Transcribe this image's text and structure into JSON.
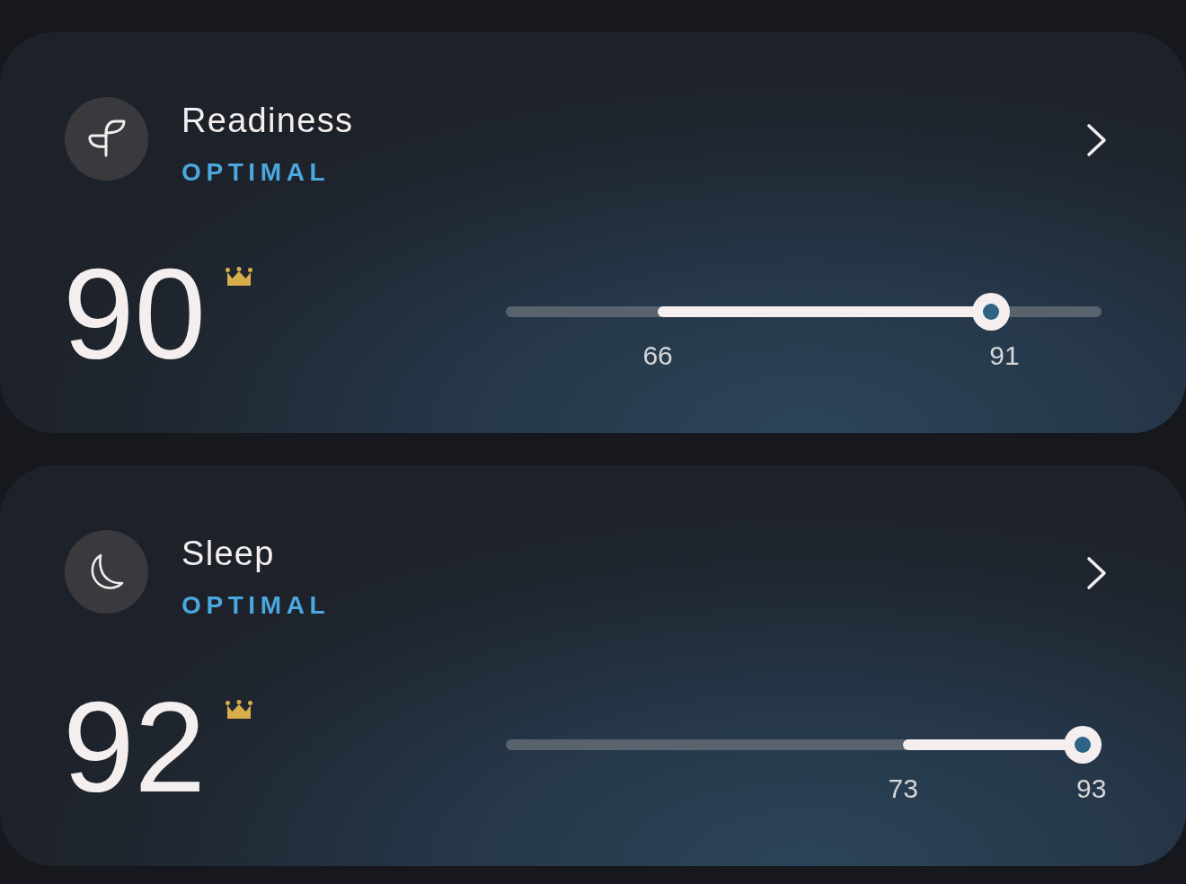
{
  "cards": [
    {
      "title": "Readiness",
      "status": "OPTIMAL",
      "score": "90",
      "crown": true,
      "slider": {
        "level": 0.814,
        "range": [
          {
            "label": "66",
            "level": 0.255
          },
          {
            "label": "91",
            "level": 0.837
          }
        ]
      }
    },
    {
      "title": "Sleep",
      "status": "OPTIMAL",
      "score": "92",
      "crown": true,
      "slider": {
        "level": 0.968,
        "range": [
          {
            "label": "73",
            "level": 0.667
          },
          {
            "label": "93",
            "level": 0.983
          }
        ]
      }
    }
  ]
}
